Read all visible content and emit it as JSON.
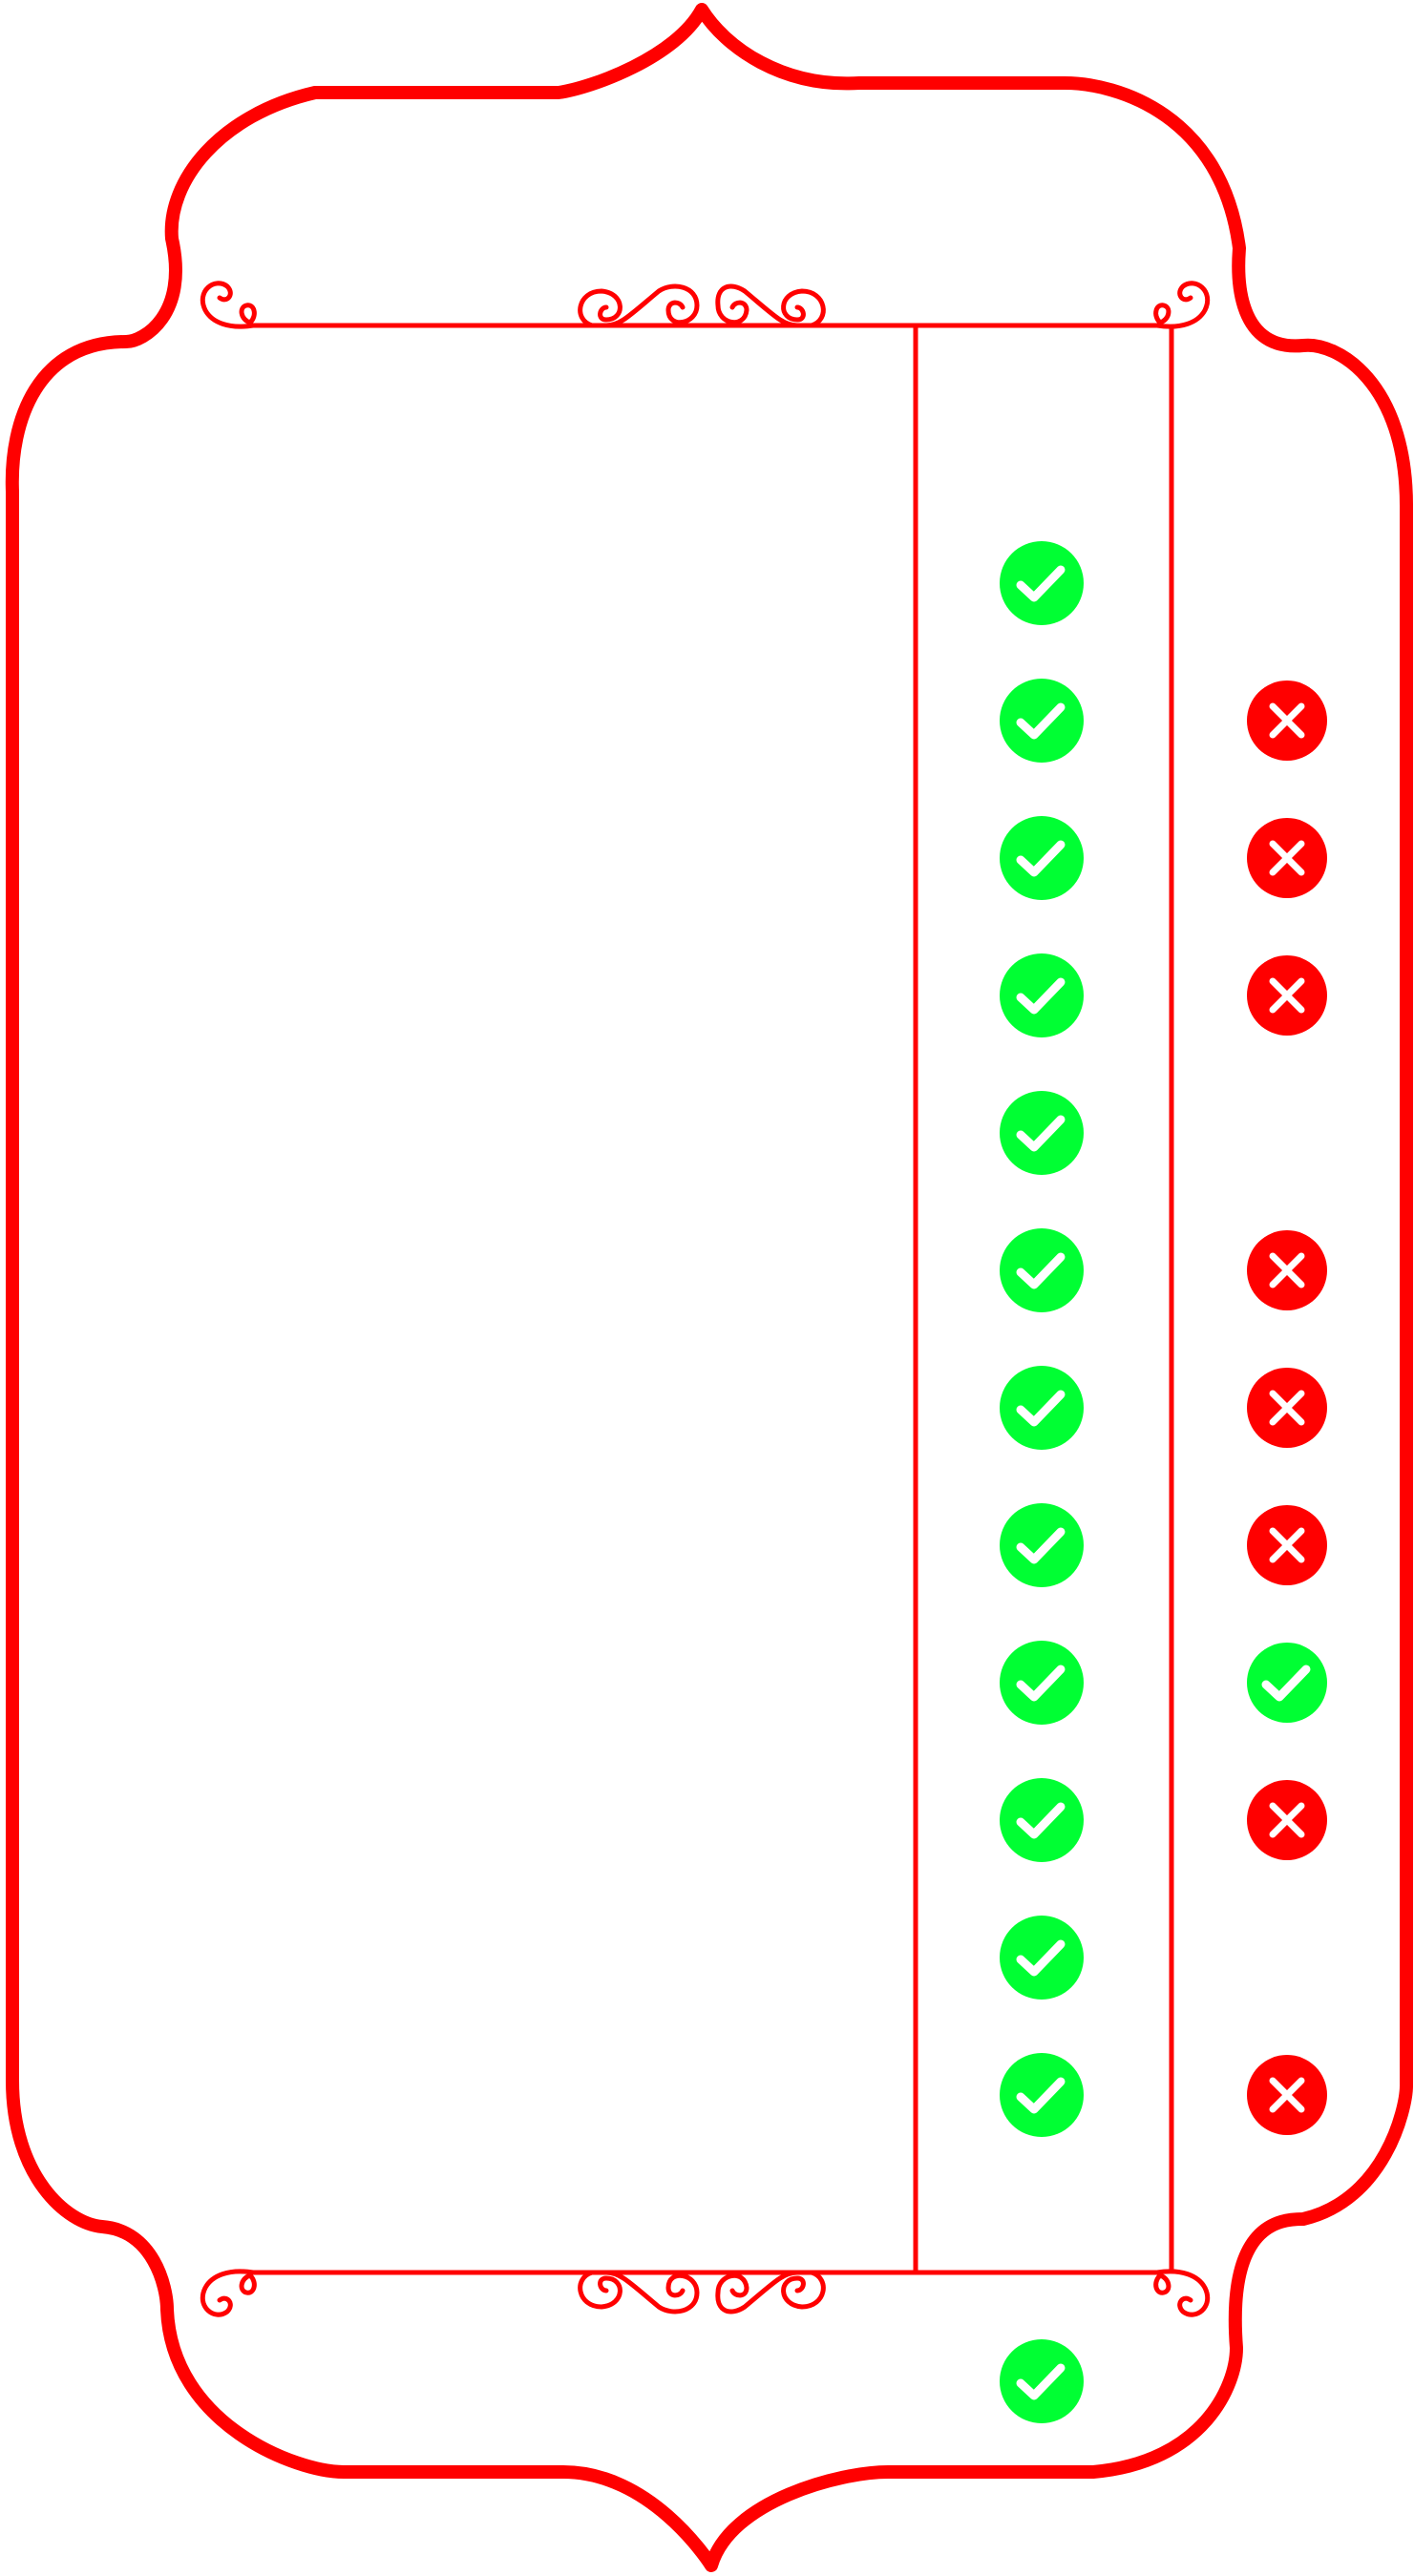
{
  "theme": {
    "frame_color": "#ff0000",
    "check_color": "#00ff33",
    "cross_color": "#ff0000",
    "mark_glyph_color": "#ffffff"
  },
  "columns": [
    {
      "name": "column-1",
      "marks": [
        "check",
        "check",
        "check",
        "check",
        "check",
        "check",
        "check",
        "check",
        "check",
        "check",
        "check",
        "check"
      ]
    },
    {
      "name": "column-2",
      "marks": [
        "none",
        "cross",
        "cross",
        "cross",
        "none",
        "cross",
        "cross",
        "cross",
        "check",
        "cross",
        "none",
        "cross"
      ]
    }
  ],
  "footer_mark": "check",
  "icons": {
    "check": "check-circle-icon",
    "cross": "cross-circle-icon"
  }
}
